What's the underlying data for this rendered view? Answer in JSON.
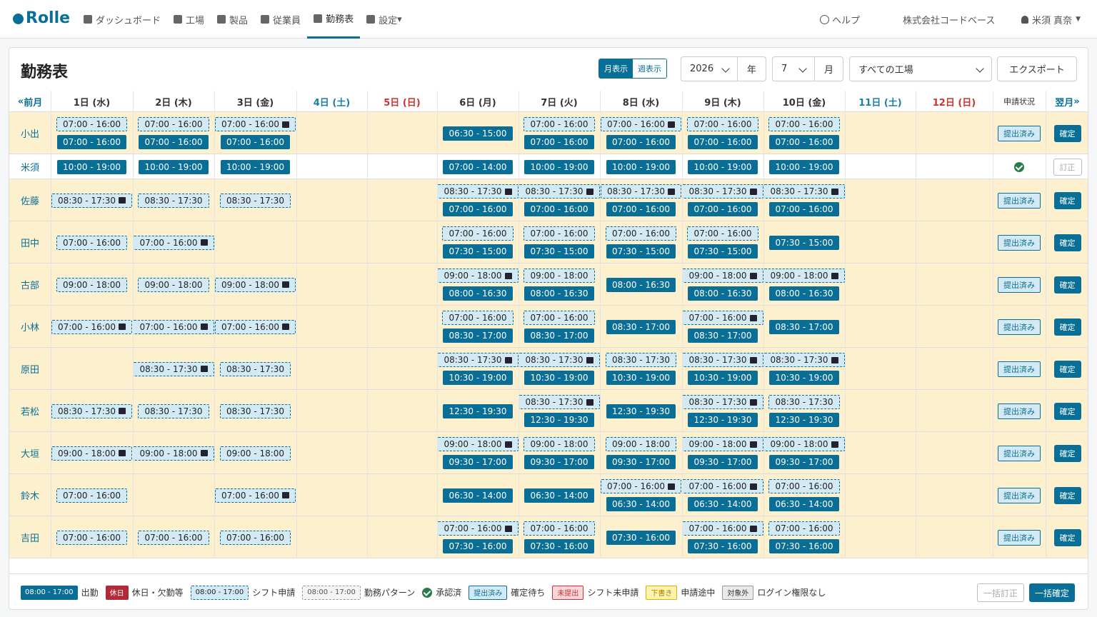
{
  "nav": {
    "logo": "Rolle",
    "items": [
      "ダッシュボード",
      "工場",
      "製品",
      "従業員",
      "勤務表",
      "設定"
    ],
    "help": "ヘルプ",
    "company": "株式会社コードベース",
    "user": "米須 真奈"
  },
  "page": {
    "title": "勤務表",
    "view_month": "月表示",
    "view_week": "週表示",
    "year": "2026",
    "year_unit": "年",
    "month": "7",
    "month_unit": "月",
    "factory": "すべての工場",
    "export": "エクスポート"
  },
  "grid": {
    "prev": "前月",
    "next": "翌月",
    "status_header": "申請状況",
    "days": [
      {
        "label": "1日 (水)",
        "type": "wd"
      },
      {
        "label": "2日 (木)",
        "type": "wd"
      },
      {
        "label": "3日 (金)",
        "type": "wd"
      },
      {
        "label": "4日 (土)",
        "type": "sat"
      },
      {
        "label": "5日 (日)",
        "type": "sun"
      },
      {
        "label": "6日 (月)",
        "type": "wd"
      },
      {
        "label": "7日 (火)",
        "type": "wd"
      },
      {
        "label": "8日 (水)",
        "type": "wd"
      },
      {
        "label": "9日 (木)",
        "type": "wd"
      },
      {
        "label": "10日 (金)",
        "type": "wd"
      },
      {
        "label": "11日 (土)",
        "type": "sat"
      },
      {
        "label": "12日 (日)",
        "type": "sun"
      }
    ],
    "rows": [
      {
        "name": "小出",
        "bg": "y",
        "status": "提出済み",
        "action": "確定",
        "cells": [
          [
            [
              "d",
              "07:00 - 16:00",
              0
            ],
            [
              "f",
              "07:00 - 16:00",
              0
            ]
          ],
          [
            [
              "d",
              "07:00 - 16:00",
              0
            ],
            [
              "f",
              "07:00 - 16:00",
              0
            ]
          ],
          [
            [
              "d",
              "07:00 - 16:00",
              1
            ],
            [
              "f",
              "07:00 - 16:00",
              0
            ]
          ],
          [],
          [],
          [
            [
              "f",
              "06:30 - 15:00",
              0
            ]
          ],
          [
            [
              "d",
              "07:00 - 16:00",
              0
            ],
            [
              "f",
              "07:00 - 16:00",
              0
            ]
          ],
          [
            [
              "d",
              "07:00 - 16:00",
              1
            ],
            [
              "f",
              "07:00 - 16:00",
              0
            ]
          ],
          [
            [
              "d",
              "07:00 - 16:00",
              0
            ],
            [
              "f",
              "07:00 - 16:00",
              0
            ]
          ],
          [
            [
              "d",
              "07:00 - 16:00",
              0
            ],
            [
              "f",
              "07:00 - 16:00",
              0
            ]
          ],
          [],
          []
        ]
      },
      {
        "name": "米須",
        "bg": "w",
        "status": "check",
        "action": "訂正",
        "cells": [
          [
            [
              "f",
              "10:00 - 19:00",
              0
            ]
          ],
          [
            [
              "f",
              "10:00 - 19:00",
              0
            ]
          ],
          [
            [
              "f",
              "10:00 - 19:00",
              0
            ]
          ],
          [],
          [],
          [
            [
              "f",
              "07:00 - 14:00",
              0
            ]
          ],
          [
            [
              "f",
              "10:00 - 19:00",
              0
            ]
          ],
          [
            [
              "f",
              "10:00 - 19:00",
              0
            ]
          ],
          [
            [
              "f",
              "10:00 - 19:00",
              0
            ]
          ],
          [
            [
              "f",
              "10:00 - 19:00",
              0
            ]
          ],
          [],
          []
        ]
      },
      {
        "name": "佐藤",
        "bg": "y",
        "status": "提出済み",
        "action": "確定",
        "cells": [
          [
            [
              "d",
              "08:30 - 17:30",
              1
            ]
          ],
          [
            [
              "d",
              "08:30 - 17:30",
              0
            ]
          ],
          [
            [
              "d",
              "08:30 - 17:30",
              0
            ]
          ],
          [],
          [],
          [
            [
              "d",
              "08:30 - 17:30",
              1
            ],
            [
              "f",
              "07:00 - 16:00",
              0
            ]
          ],
          [
            [
              "d",
              "08:30 - 17:30",
              1
            ],
            [
              "f",
              "07:00 - 16:00",
              0
            ]
          ],
          [
            [
              "d",
              "08:30 - 17:30",
              1
            ],
            [
              "f",
              "07:00 - 16:00",
              0
            ]
          ],
          [
            [
              "d",
              "08:30 - 17:30",
              1
            ],
            [
              "f",
              "07:00 - 16:00",
              0
            ]
          ],
          [
            [
              "d",
              "08:30 - 17:30",
              1
            ],
            [
              "f",
              "07:00 - 16:00",
              0
            ]
          ],
          [],
          []
        ]
      },
      {
        "name": "田中",
        "bg": "y",
        "status": "提出済み",
        "action": "確定",
        "cells": [
          [
            [
              "d",
              "07:00 - 16:00",
              0
            ]
          ],
          [
            [
              "d",
              "07:00 - 16:00",
              1
            ]
          ],
          [],
          [],
          [],
          [
            [
              "d",
              "07:00 - 16:00",
              0
            ],
            [
              "f",
              "07:30 - 15:00",
              0
            ]
          ],
          [
            [
              "d",
              "07:00 - 16:00",
              0
            ],
            [
              "f",
              "07:30 - 15:00",
              0
            ]
          ],
          [
            [
              "d",
              "07:00 - 16:00",
              0
            ],
            [
              "f",
              "07:30 - 15:00",
              0
            ]
          ],
          [
            [
              "d",
              "07:00 - 16:00",
              0
            ],
            [
              "f",
              "07:30 - 15:00",
              0
            ]
          ],
          [
            [
              "f",
              "07:30 - 15:00",
              0
            ]
          ],
          [],
          []
        ]
      },
      {
        "name": "古部",
        "bg": "y",
        "status": "提出済み",
        "action": "確定",
        "cells": [
          [
            [
              "d",
              "09:00 - 18:00",
              0
            ]
          ],
          [
            [
              "d",
              "09:00 - 18:00",
              0
            ]
          ],
          [
            [
              "d",
              "09:00 - 18:00",
              1
            ]
          ],
          [],
          [],
          [
            [
              "d",
              "09:00 - 18:00",
              1
            ],
            [
              "f",
              "08:00 - 16:30",
              0
            ]
          ],
          [
            [
              "d",
              "09:00 - 18:00",
              0
            ],
            [
              "f",
              "08:00 - 16:30",
              0
            ]
          ],
          [
            [
              "f",
              "08:00 - 16:30",
              0
            ]
          ],
          [
            [
              "d",
              "09:00 - 18:00",
              1
            ],
            [
              "f",
              "08:00 - 16:30",
              0
            ]
          ],
          [
            [
              "d",
              "09:00 - 18:00",
              1
            ],
            [
              "f",
              "08:00 - 16:30",
              0
            ]
          ],
          [],
          []
        ]
      },
      {
        "name": "小林",
        "bg": "y",
        "status": "提出済み",
        "action": "確定",
        "cells": [
          [
            [
              "d",
              "07:00 - 16:00",
              1
            ]
          ],
          [
            [
              "d",
              "07:00 - 16:00",
              1
            ]
          ],
          [
            [
              "d",
              "07:00 - 16:00",
              1
            ]
          ],
          [],
          [],
          [
            [
              "d",
              "07:00 - 16:00",
              0
            ],
            [
              "f",
              "08:30 - 17:00",
              0
            ]
          ],
          [
            [
              "d",
              "07:00 - 16:00",
              0
            ],
            [
              "f",
              "08:30 - 17:00",
              0
            ]
          ],
          [
            [
              "f",
              "08:30 - 17:00",
              0
            ]
          ],
          [
            [
              "d",
              "07:00 - 16:00",
              1
            ],
            [
              "f",
              "08:30 - 17:00",
              0
            ]
          ],
          [
            [
              "f",
              "08:30 - 17:00",
              0
            ]
          ],
          [],
          []
        ]
      },
      {
        "name": "原田",
        "bg": "y",
        "status": "提出済み",
        "action": "確定",
        "cells": [
          [],
          [
            [
              "d",
              "08:30 - 17:30",
              1
            ]
          ],
          [
            [
              "d",
              "08:30 - 17:30",
              0
            ]
          ],
          [],
          [],
          [
            [
              "d",
              "08:30 - 17:30",
              1
            ],
            [
              "f",
              "10:30 - 19:00",
              0
            ]
          ],
          [
            [
              "d",
              "08:30 - 17:30",
              1
            ],
            [
              "f",
              "10:30 - 19:00",
              0
            ]
          ],
          [
            [
              "d",
              "08:30 - 17:30",
              0
            ],
            [
              "f",
              "10:30 - 19:00",
              0
            ]
          ],
          [
            [
              "d",
              "08:30 - 17:30",
              1
            ],
            [
              "f",
              "10:30 - 19:00",
              0
            ]
          ],
          [
            [
              "d",
              "08:30 - 17:30",
              1
            ],
            [
              "f",
              "10:30 - 19:00",
              0
            ]
          ],
          [],
          []
        ]
      },
      {
        "name": "若松",
        "bg": "y",
        "status": "提出済み",
        "action": "確定",
        "cells": [
          [
            [
              "d",
              "08:30 - 17:30",
              1
            ]
          ],
          [
            [
              "d",
              "08:30 - 17:30",
              0
            ]
          ],
          [
            [
              "d",
              "08:30 - 17:30",
              0
            ]
          ],
          [],
          [],
          [
            [
              "f",
              "12:30 - 19:30",
              0
            ]
          ],
          [
            [
              "d",
              "08:30 - 17:30",
              1
            ],
            [
              "f",
              "12:30 - 19:30",
              0
            ]
          ],
          [
            [
              "f",
              "12:30 - 19:30",
              0
            ]
          ],
          [
            [
              "d",
              "08:30 - 17:30",
              1
            ],
            [
              "f",
              "12:30 - 19:30",
              0
            ]
          ],
          [
            [
              "d",
              "08:30 - 17:30",
              0
            ],
            [
              "f",
              "12:30 - 19:30",
              0
            ]
          ],
          [],
          []
        ]
      },
      {
        "name": "大垣",
        "bg": "y",
        "status": "提出済み",
        "action": "確定",
        "cells": [
          [
            [
              "d",
              "09:00 - 18:00",
              1
            ]
          ],
          [
            [
              "d",
              "09:00 - 18:00",
              1
            ]
          ],
          [
            [
              "d",
              "09:00 - 18:00",
              0
            ]
          ],
          [],
          [],
          [
            [
              "d",
              "09:00 - 18:00",
              1
            ],
            [
              "f",
              "09:30 - 17:00",
              0
            ]
          ],
          [
            [
              "d",
              "09:00 - 18:00",
              0
            ],
            [
              "f",
              "09:30 - 17:00",
              0
            ]
          ],
          [
            [
              "d",
              "09:00 - 18:00",
              0
            ],
            [
              "f",
              "09:30 - 17:00",
              0
            ]
          ],
          [
            [
              "d",
              "09:00 - 18:00",
              1
            ],
            [
              "f",
              "09:30 - 17:00",
              0
            ]
          ],
          [
            [
              "d",
              "09:00 - 18:00",
              1
            ],
            [
              "f",
              "09:30 - 17:00",
              0
            ]
          ],
          [],
          []
        ]
      },
      {
        "name": "鈴木",
        "bg": "y",
        "status": "提出済み",
        "action": "確定",
        "cells": [
          [
            [
              "d",
              "07:00 - 16:00",
              0
            ]
          ],
          [],
          [
            [
              "d",
              "07:00 - 16:00",
              1
            ]
          ],
          [],
          [],
          [
            [
              "f",
              "06:30 - 14:00",
              0
            ]
          ],
          [
            [
              "f",
              "06:30 - 14:00",
              0
            ]
          ],
          [
            [
              "d",
              "07:00 - 16:00",
              1
            ],
            [
              "f",
              "06:30 - 14:00",
              0
            ]
          ],
          [
            [
              "d",
              "07:00 - 16:00",
              1
            ],
            [
              "f",
              "06:30 - 14:00",
              0
            ]
          ],
          [
            [
              "d",
              "07:00 - 16:00",
              0
            ],
            [
              "f",
              "06:30 - 14:00",
              0
            ]
          ],
          [],
          []
        ]
      },
      {
        "name": "吉田",
        "bg": "y",
        "status": "提出済み",
        "action": "確定",
        "cells": [
          [
            [
              "d",
              "07:00 - 16:00",
              0
            ]
          ],
          [
            [
              "d",
              "07:00 - 16:00",
              0
            ]
          ],
          [
            [
              "d",
              "07:00 - 16:00",
              0
            ]
          ],
          [],
          [],
          [
            [
              "d",
              "07:00 - 16:00",
              1
            ],
            [
              "f",
              "07:30 - 16:00",
              0
            ]
          ],
          [
            [
              "d",
              "07:00 - 16:00",
              0
            ],
            [
              "f",
              "07:30 - 16:00",
              0
            ]
          ],
          [
            [
              "f",
              "07:30 - 16:00",
              0
            ]
          ],
          [
            [
              "d",
              "07:00 - 16:00",
              1
            ],
            [
              "f",
              "07:30 - 16:00",
              0
            ]
          ],
          [
            [
              "d",
              "07:00 - 16:00",
              0
            ],
            [
              "f",
              "07:30 - 16:00",
              0
            ]
          ],
          [],
          []
        ]
      }
    ]
  },
  "legend": [
    {
      "badge": "08:00 - 17:00",
      "style": "fill",
      "label": "出勤"
    },
    {
      "badge": "休日",
      "style": "red",
      "label": "休日・欠勤等"
    },
    {
      "badge": "08:00 - 17:00",
      "style": "dash",
      "label": "シフト申請"
    },
    {
      "badge": "08:00 - 17:00",
      "style": "grey",
      "label": "勤務パターン"
    },
    {
      "badge": "",
      "style": "check",
      "label": "承認済"
    },
    {
      "badge": "提出済み",
      "style": "sub",
      "label": "確定待ち"
    },
    {
      "badge": "未提出",
      "style": "pink",
      "label": "シフト未申請"
    },
    {
      "badge": "下書き",
      "style": "yellow",
      "label": "申請途中"
    },
    {
      "badge": "対象外",
      "style": "gray2",
      "label": "ログイン権限なし"
    }
  ],
  "footer": {
    "bulk_correct": "一括訂正",
    "bulk_confirm": "一括確定"
  }
}
